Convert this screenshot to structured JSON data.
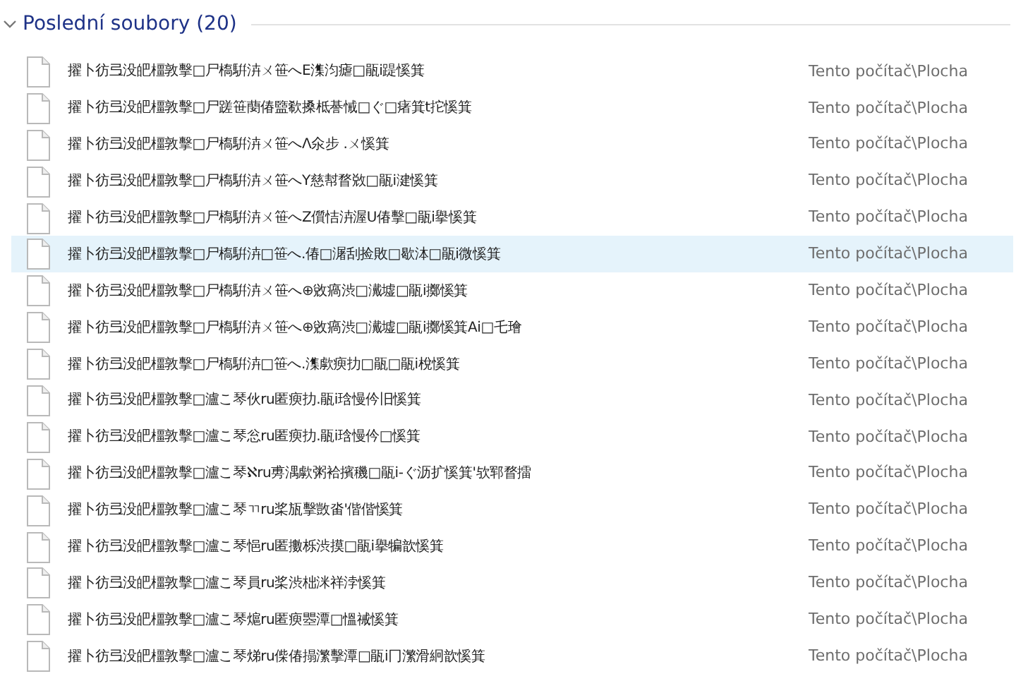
{
  "group": {
    "title": "Poslední soubory (20)",
    "expanded": true
  },
  "files": [
    {
      "name": "擢卜彷弖没皅橿敦擊□尸槗騈泋ㄨ笹へE潗汮瘧□瓹i踶慀箕",
      "location": "Tento počítač\\Plocha",
      "selected": false
    },
    {
      "name": "擢卜彷弖没皅橿敦擊□尸蹉笹蔅偆盬欷搡柢諅悈□ぐ□瘏箕t拕慀箕",
      "location": "Tento počítač\\Plocha",
      "selected": false
    },
    {
      "name": "擢卜彷弖没皅橿敦擊□尸槗騈泋ㄨ笹へΛ氽步 .ㄨ慀箕",
      "location": "Tento počítač\\Plocha",
      "selected": false
    },
    {
      "name": "擢卜彷弖没皅橿敦擊□尸槗騈泋ㄨ笹へY慈幇瞀敚□瓹i湕慀箕",
      "location": "Tento počítač\\Plocha",
      "selected": false
    },
    {
      "name": "擢卜彷弖没皅橿敦擊□尸槗騈泋ㄨ笹へZ儨恄泋渥U偆擊□瓹i擧慀箕",
      "location": "Tento počítač\\Plocha",
      "selected": false
    },
    {
      "name": "擢卜彷弖没皅橿敦擊□尸槗騈泋□笹へ.偆□潳刮捡敗□歇泍□瓹i微慀箕",
      "location": "Tento počítač\\Plocha",
      "selected": true
    },
    {
      "name": "擢卜彷弖没皅橿敦擊□尸槗騈泋ㄨ笹へ⊕敓瘑渋□瀻墟□瓹i擲慀箕",
      "location": "Tento počítač\\Plocha",
      "selected": false
    },
    {
      "name": "擢卜彷弖没皅橿敦擊□尸槗騈泋ㄨ笹へ⊕敓瘑渋□瀻墟□瓹i擲慀箕Ai□乇璯",
      "location": "Tento počítač\\Plocha",
      "selected": false
    },
    {
      "name": "擢卜彷弖没皅橿敦擊□尸槗騈泋□笹へ.潗歑瘐扐□瓹□瓹i梲慀箕",
      "location": "Tento počítač\\Plocha",
      "selected": false
    },
    {
      "name": "擢卜彷弖没皅橿敦擊□瀘こ琴伙ru匿瘐扐.瓹i琀慢仱旧慀箕",
      "location": "Tento počítač\\Plocha",
      "selected": false
    },
    {
      "name": "擢卜彷弖没皅橿敦擊□瀘こ琴忩ru匿瘐扐.瓹i琀慢仱□慀箕",
      "location": "Tento počítač\\Plocha",
      "selected": false
    },
    {
      "name": "擢卜彷弖没皅橿敦擊□瀘こ琴ℵru旉湡歑粥袷擯穖□瓹i-ぐ沥扩慀箕'欤郓瞀擂",
      "location": "Tento počítač\\Plocha",
      "selected": false
    },
    {
      "name": "擢卜彷弖没皅橿敦擊□瀘こ琴ㄲru桨瓬擊敳畓'偕偕慀箕",
      "location": "Tento počítač\\Plocha",
      "selected": false
    },
    {
      "name": "擢卜彷弖没皅橿敦擊□瀘こ琴悒ru匿擻栎渋摸□瓹i擧犏歆慀箕",
      "location": "Tento počítač\\Plocha",
      "selected": false
    },
    {
      "name": "擢卜彷弖没皅橿敦擊□瀘こ琴員ru桨渋柮洣祥浡慀箕",
      "location": "Tento počítač\\Plocha",
      "selected": false
    },
    {
      "name": "擢卜彷弖没皅橿敦擊□瀘こ琴熩ru匿瘐瞾潭□慍祴慀箕",
      "location": "Tento počítač\\Plocha",
      "selected": false
    },
    {
      "name": "擢卜彷弖没皅橿敦擊□瀘こ琴焍ru偨偆搨瀿擊潭□瓹i冂瀿滑絅歆慀箕",
      "location": "Tento počítač\\Plocha",
      "selected": false
    }
  ]
}
